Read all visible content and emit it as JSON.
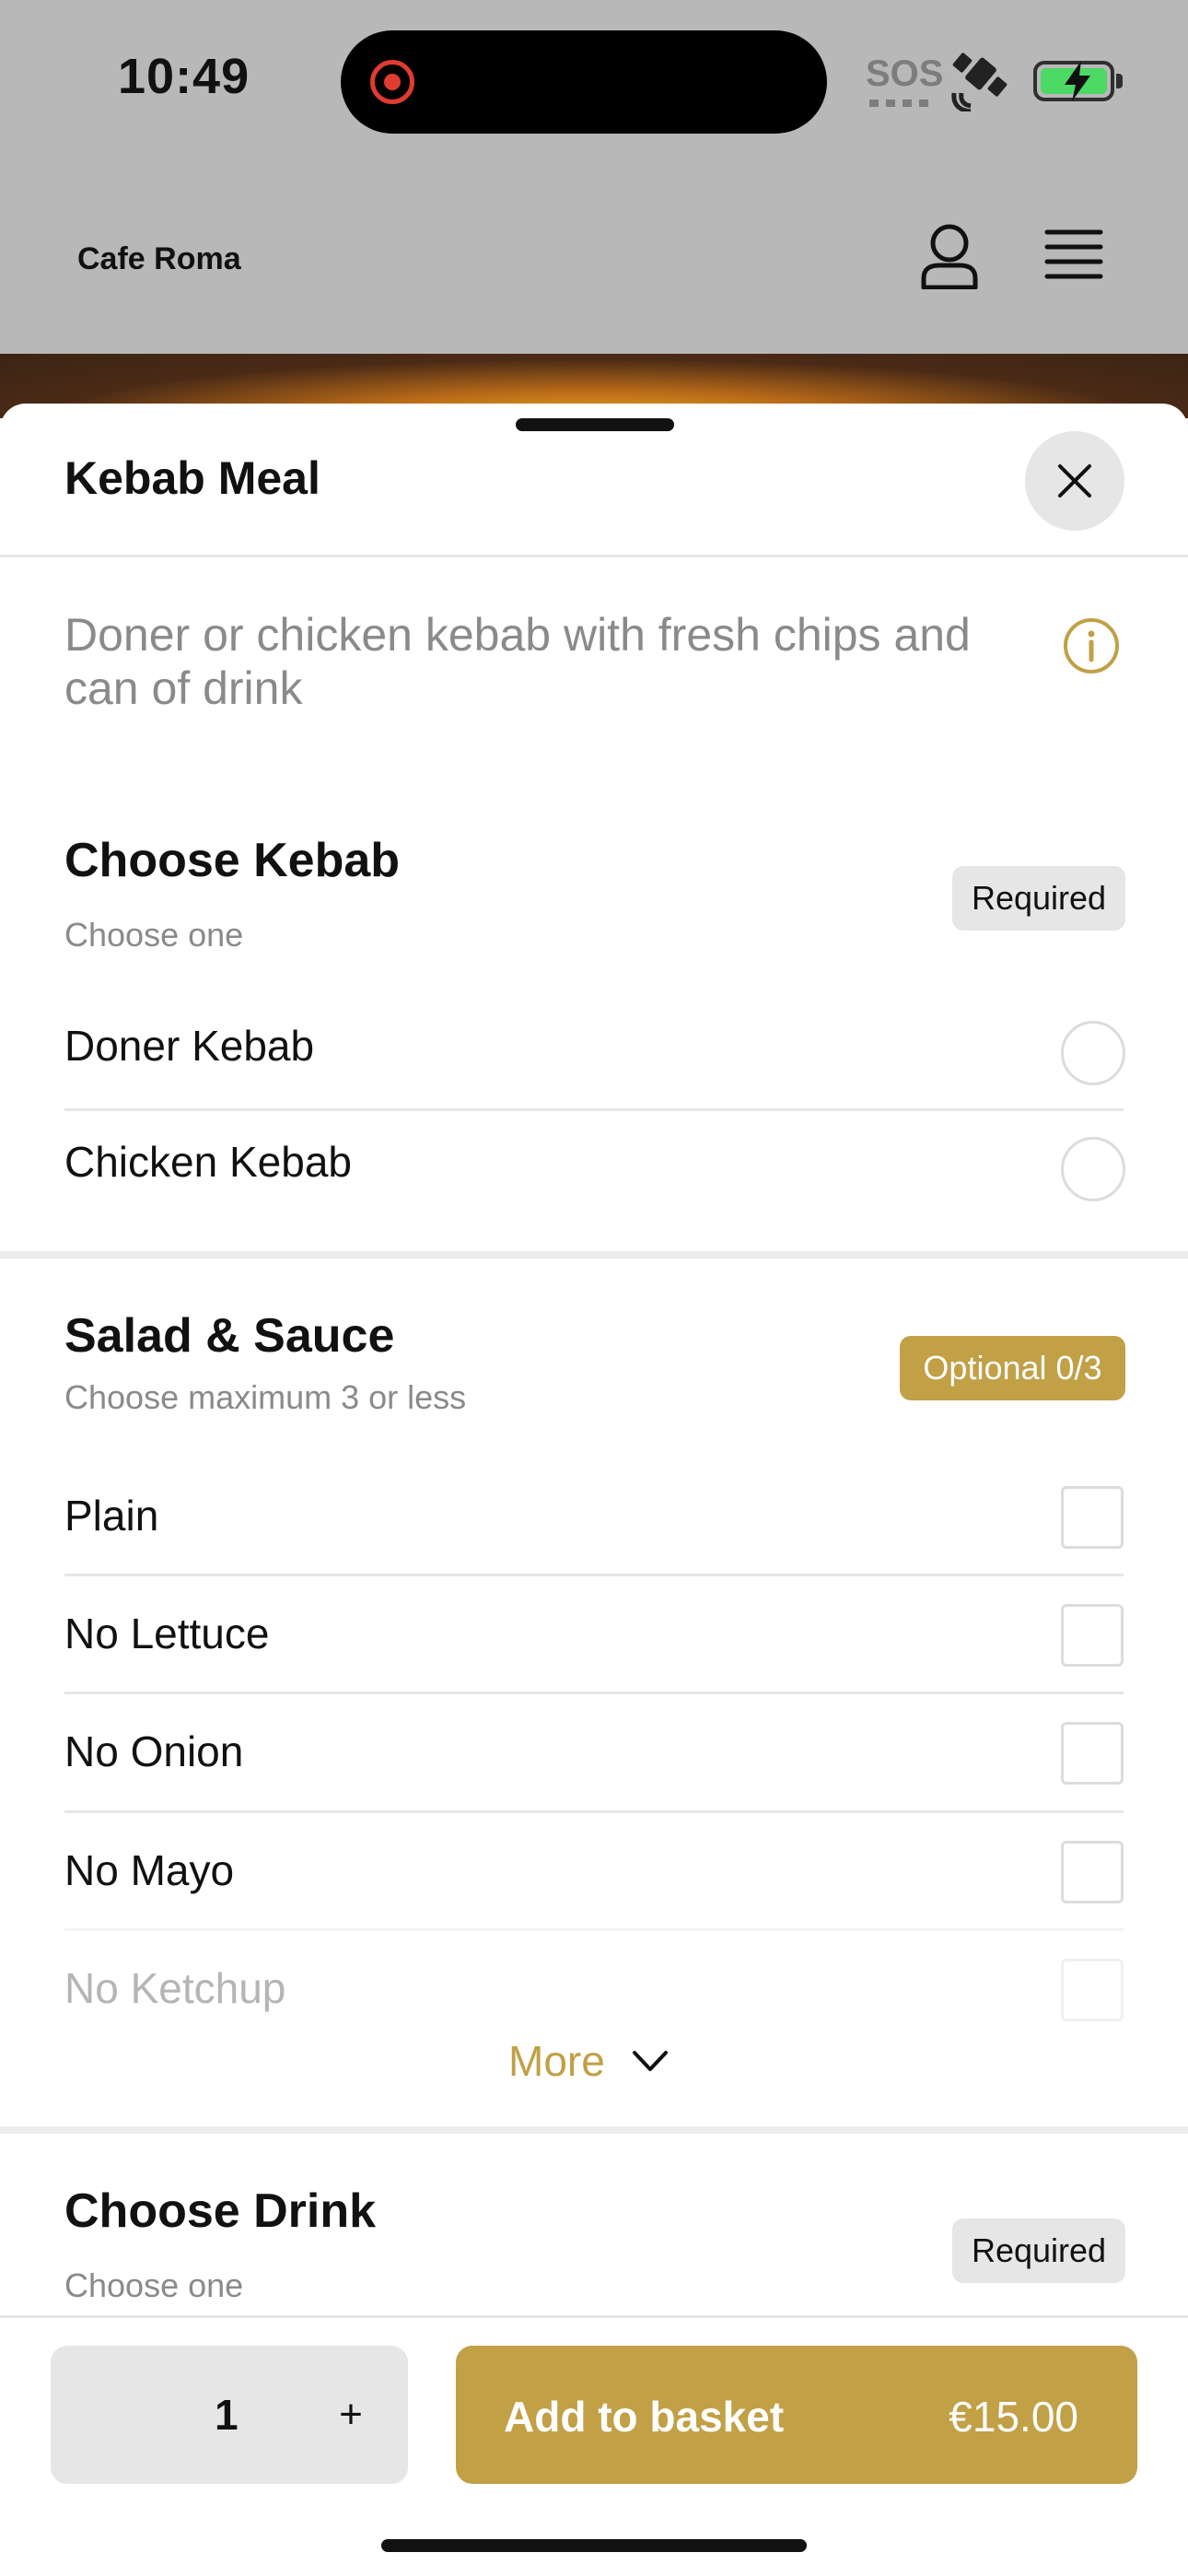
{
  "status_bar": {
    "time": "10:49",
    "sos": "SOS"
  },
  "header": {
    "brand": "Cafe Roma",
    "account_icon": "user-icon",
    "menu_icon": "hamburger-menu-icon"
  },
  "sheet": {
    "title": "Kebab Meal",
    "close_icon": "close-icon",
    "description": "Doner or chicken kebab with fresh chips and can of drink",
    "info_icon": "info-icon"
  },
  "sections": {
    "kebab": {
      "title": "Choose Kebab",
      "subtitle": "Choose one",
      "badge": "Required",
      "options": [
        "Doner Kebab",
        "Chicken Kebab"
      ]
    },
    "salad": {
      "title": "Salad & Sauce",
      "subtitle": "Choose maximum 3 or less",
      "badge": "Optional 0/3",
      "options": [
        "Plain",
        "No Lettuce",
        "No Onion",
        "No Mayo",
        "No Ketchup"
      ],
      "more_label": "More"
    },
    "drink": {
      "title": "Choose Drink",
      "subtitle": "Choose one",
      "badge": "Required"
    }
  },
  "footer": {
    "quantity": "1",
    "plus_label": "+",
    "add_label": "Add to basket",
    "price": "€15.00"
  },
  "colors": {
    "accent": "#c1a046",
    "chip_bg": "#e6e6e6",
    "header_bg": "#b8b8b8"
  }
}
